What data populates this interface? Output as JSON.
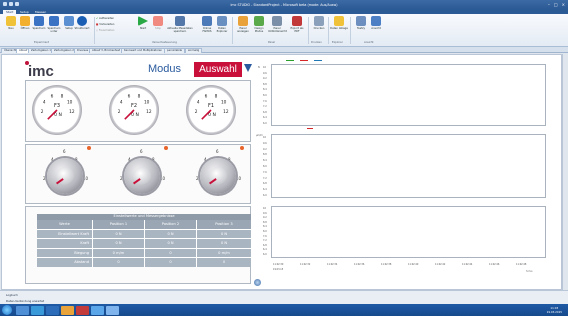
{
  "window": {
    "title": "imc STUDIO - StandardProject - Microsoft beta (mode: Aus/Ausw)"
  },
  "menu_tabs": [
    "Start",
    "Setup",
    "Messen"
  ],
  "ribbon": {
    "groups": [
      {
        "label": "Experiment",
        "buttons": [
          "Neu",
          "Öffnen",
          "Speichern",
          "Speichern unter",
          "Setup",
          "Strukturiert"
        ]
      },
      {
        "label": "Versuchssteuerung",
        "buttons": [
          "Aufbereiten",
          "Vorbereiten",
          "Freischalten",
          "Start",
          "Stop",
          "Aktuelle Messdaten speichern",
          "Online FAMOS",
          "Daten Explorer"
        ]
      },
      {
        "label": "Panel",
        "buttons": [
          "Panel anzeigen",
          "Design Modus",
          "Panel Vollbildansicht",
          "Export als PDF"
        ]
      },
      {
        "label": "Drucken",
        "buttons": [
          "Drucken"
        ]
      },
      {
        "label": "Explorer",
        "buttons": [
          "Daten Ablage"
        ]
      },
      {
        "label": "Ansicht",
        "buttons": [
          "Testzy",
          "Ansicht"
        ]
      }
    ]
  },
  "doc_tabs": [
    "Übersicht",
    "Ablauf",
    "Zeitumgaben 1",
    "Zeitumgaben 2",
    "Diverses",
    "Ablauf 3, Brückentest",
    "Kennwert und Multiplikatoren",
    "peroxilabile",
    "einmalig"
  ],
  "panel": {
    "logo": "imc",
    "modus_label": "Modus",
    "auswahl_label": "Auswahl",
    "gauges": [
      {
        "label": "F3",
        "unit": "0 N",
        "scale": [
          "2",
          "4",
          "6",
          "8",
          "10",
          "12"
        ],
        "value": 0
      },
      {
        "label": "F2",
        "unit": "0 N",
        "scale": [
          "2",
          "4",
          "6",
          "8",
          "10",
          "12"
        ],
        "value": 0
      },
      {
        "label": "F1",
        "unit": "0 N",
        "scale": [
          "2",
          "4",
          "6",
          "8",
          "10",
          "12"
        ],
        "value": 0
      }
    ],
    "knobs": [
      {
        "ticks": [
          "2",
          "4",
          "6",
          "8",
          "10"
        ],
        "alarm": true
      },
      {
        "ticks": [
          "2",
          "4",
          "6",
          "8",
          "10"
        ],
        "alarm": true
      },
      {
        "ticks": [
          "2",
          "4",
          "6",
          "8",
          "10"
        ],
        "alarm": true
      }
    ],
    "table": {
      "title": "Einstellwerte und Messergebnisse",
      "columns": [
        "Werte",
        "Position 1",
        "Position 2",
        "Position 3"
      ],
      "rows": [
        {
          "label": "Einstellwert Kraft",
          "values": [
            "0 N",
            "0 N",
            "0 N"
          ]
        },
        {
          "label": "Kraft",
          "values": [
            "0 N",
            "0 N",
            "0 N"
          ]
        },
        {
          "label": "Biegung",
          "values": [
            "0 m/m",
            "0",
            "0 m/m"
          ]
        },
        {
          "label": "Abstand",
          "values": [
            "0",
            "0",
            "0"
          ]
        }
      ]
    }
  },
  "charts": {
    "ylabels_top": [
      "10",
      "9.6",
      "9.2",
      "8.8",
      "8.4",
      "8.0",
      "7.6",
      "7.2",
      "6.8",
      "6.4",
      "6.0"
    ],
    "y_axis_1": "N",
    "y_axis_2": "μm/m",
    "x_ticks": [
      "11:02:30",
      "11:02:32",
      "11:02:34",
      "11:02:36",
      "11:02:38",
      "11:02:40",
      "11:02:42",
      "11:02:44",
      "11:02:46",
      "11:02:48"
    ],
    "x_date": "19.03.15",
    "x_unit": "h:m:s",
    "legend_colors": [
      "#2ca02c",
      "#d62728",
      "#1f77b4"
    ]
  },
  "status": {
    "line1": "Logbuch",
    "line2": "Daten-Verbindung erwartet"
  },
  "taskbar": {
    "time": "11:03",
    "date": "19.03.2015"
  }
}
